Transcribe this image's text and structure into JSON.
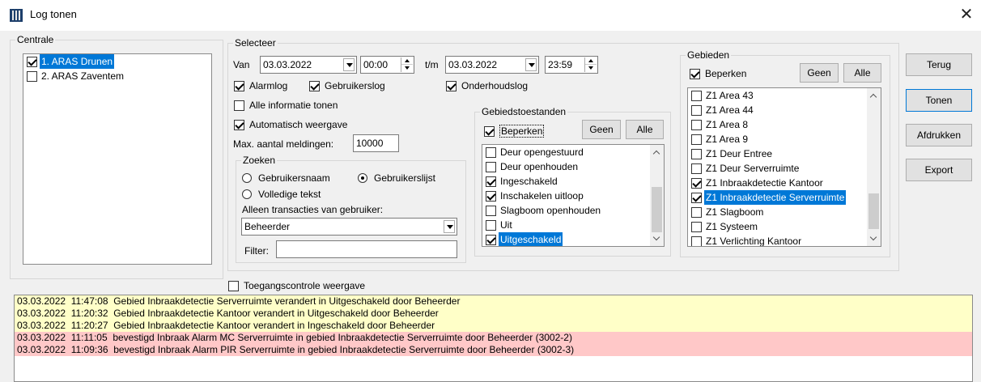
{
  "window": {
    "title": "Log tonen",
    "close_glyph": "✕"
  },
  "centrale": {
    "legend": "Centrale",
    "items": [
      {
        "label": "1. ARAS Drunen",
        "checked": true,
        "selected": true
      },
      {
        "label": "2. ARAS Zaventem",
        "checked": false,
        "selected": false
      }
    ]
  },
  "selecteer": {
    "legend": "Selecteer",
    "van_label": "Van",
    "date_from": "03.03.2022",
    "time_from": "00:00",
    "tm_label": "t/m",
    "date_to": "03.03.2022",
    "time_to": "23:59",
    "alarmlog": {
      "label": "Alarmlog",
      "checked": true
    },
    "gebruikerslog": {
      "label": "Gebruikerslog",
      "checked": true
    },
    "onderhoudslog": {
      "label": "Onderhoudslog",
      "checked": true
    },
    "alle_info": {
      "label": "Alle informatie tonen",
      "checked": false
    },
    "auto_weergave": {
      "label": "Automatisch weergave",
      "checked": true
    },
    "max_label": "Max. aantal meldingen:",
    "max_value": "10000"
  },
  "zoeken": {
    "legend": "Zoeken",
    "gebruikersnaam": {
      "label": "Gebruikersnaam",
      "checked": false
    },
    "gebruikerslijst": {
      "label": "Gebruikerslijst",
      "checked": true
    },
    "volledige_tekst": {
      "label": "Volledige tekst",
      "checked": false
    },
    "alleen_label": "Alleen transacties van gebruiker:",
    "gebruiker_value": "Beheerder",
    "filter_label": "Filter:",
    "filter_value": ""
  },
  "gebiedstoestanden": {
    "legend": "Gebiedstoestanden",
    "beperken": {
      "label": "Beperken",
      "checked": true
    },
    "geen_label": "Geen",
    "alle_label": "Alle",
    "items": [
      {
        "label": "Deur opengestuurd",
        "checked": false,
        "selected": false
      },
      {
        "label": "Deur openhouden",
        "checked": false,
        "selected": false
      },
      {
        "label": "Ingeschakeld",
        "checked": true,
        "selected": false
      },
      {
        "label": "Inschakelen uitloop",
        "checked": true,
        "selected": false
      },
      {
        "label": "Slagboom openhouden",
        "checked": false,
        "selected": false
      },
      {
        "label": "Uit",
        "checked": false,
        "selected": false
      },
      {
        "label": "Uitgeschakeld",
        "checked": true,
        "selected": true
      }
    ]
  },
  "gebieden": {
    "legend": "Gebieden",
    "beperken": {
      "label": "Beperken",
      "checked": true
    },
    "geen_label": "Geen",
    "alle_label": "Alle",
    "items": [
      {
        "label": "Z1 Area 43",
        "checked": false,
        "selected": false
      },
      {
        "label": "Z1 Area 44",
        "checked": false,
        "selected": false
      },
      {
        "label": "Z1 Area 8",
        "checked": false,
        "selected": false
      },
      {
        "label": "Z1 Area 9",
        "checked": false,
        "selected": false
      },
      {
        "label": "Z1 Deur Entree",
        "checked": false,
        "selected": false
      },
      {
        "label": "Z1 Deur Serverruimte",
        "checked": false,
        "selected": false
      },
      {
        "label": "Z1 Inbraakdetectie Kantoor",
        "checked": true,
        "selected": false
      },
      {
        "label": "Z1 Inbraakdetectie Serverruimte",
        "checked": true,
        "selected": true
      },
      {
        "label": "Z1 Slagboom",
        "checked": false,
        "selected": false
      },
      {
        "label": "Z1 Systeem",
        "checked": false,
        "selected": false
      },
      {
        "label": "Z1 Verlichting Kantoor",
        "checked": false,
        "selected": false
      }
    ]
  },
  "buttons": {
    "terug": "Terug",
    "tonen": "Tonen",
    "afdrukken": "Afdrukken",
    "export": "Export"
  },
  "toegang": {
    "label": "Toegangscontrole weergave",
    "checked": false
  },
  "colors": {
    "selection": "#0078d7",
    "log_yellow": "#ffffc8",
    "log_red": "#ffc8c8"
  },
  "log": [
    {
      "text": "03.03.2022  11:47:08  Gebied Inbraakdetectie Serverruimte verandert in Uitgeschakeld door Beheerder",
      "color": "yellow"
    },
    {
      "text": "03.03.2022  11:20:32  Gebied Inbraakdetectie Kantoor verandert in Uitgeschakeld door Beheerder",
      "color": "yellow"
    },
    {
      "text": "03.03.2022  11:20:27  Gebied Inbraakdetectie Kantoor verandert in Ingeschakeld door Beheerder",
      "color": "yellow"
    },
    {
      "text": "03.03.2022  11:11:05  bevestigd Inbraak Alarm MC Serverruimte in gebied Inbraakdetectie Serverruimte door Beheerder (3002-2)",
      "color": "red"
    },
    {
      "text": "03.03.2022  11:09:36  bevestigd Inbraak Alarm PIR Serverruimte in gebied Inbraakdetectie Serverruimte door Beheerder (3002-3)",
      "color": "red"
    }
  ]
}
